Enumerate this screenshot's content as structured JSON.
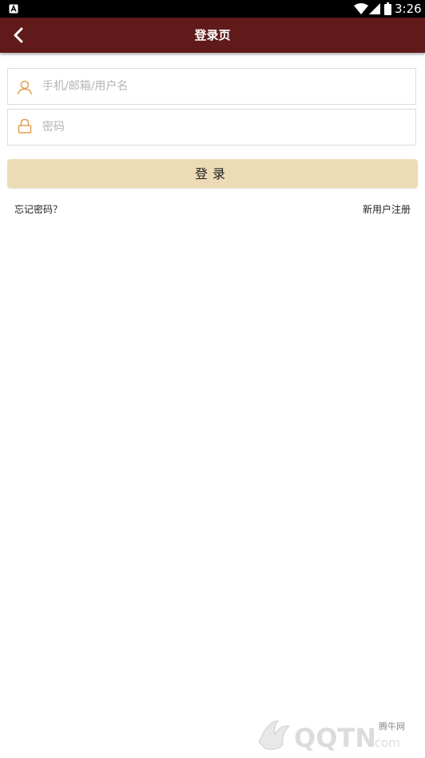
{
  "status_bar": {
    "time": "3:26",
    "notification_icon": "a-box-icon",
    "wifi_icon": "wifi-icon",
    "signal_icon": "signal-icon",
    "battery_icon": "battery-icon"
  },
  "header": {
    "title": "登录页",
    "back_icon": "chevron-left-icon",
    "background": "#5f1a19"
  },
  "form": {
    "username_placeholder": "手机/邮箱/用户名",
    "username_value": "",
    "password_placeholder": "密码",
    "password_value": "",
    "user_icon": "user-icon",
    "lock_icon": "lock-icon",
    "icon_color": "#e0a050"
  },
  "actions": {
    "login_label": "登录",
    "forgot_password": "忘记密码？",
    "register": "新用户注册",
    "login_button_color": "#eddbb6"
  },
  "watermark": {
    "brand": "QQTN.com",
    "label": "腾牛网"
  }
}
